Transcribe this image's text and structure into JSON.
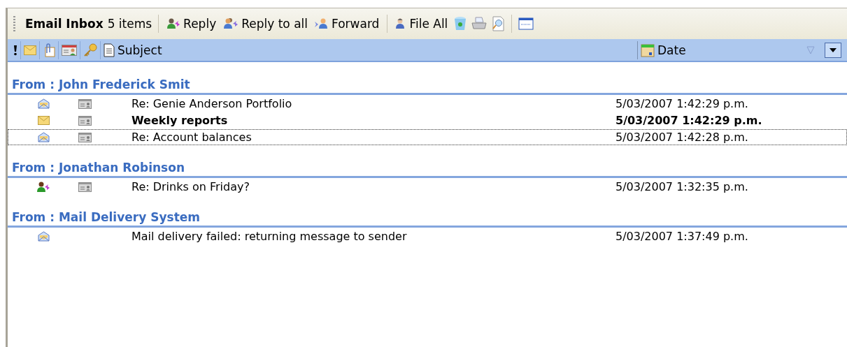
{
  "toolbar": {
    "title": "Email Inbox",
    "count": "5 items",
    "buttons": [
      {
        "kind": "reply",
        "label": "Reply"
      },
      {
        "kind": "reply_all",
        "label": "Reply to all"
      },
      {
        "kind": "forward",
        "label": "Forward"
      },
      {
        "kind": "file",
        "label": "File All"
      },
      {
        "kind": "recycle"
      },
      {
        "kind": "print"
      },
      {
        "kind": "preview"
      },
      {
        "kind": "window"
      }
    ]
  },
  "columns": [
    {
      "kind": "importance"
    },
    {
      "kind": "status"
    },
    {
      "kind": "attachment"
    },
    {
      "kind": "card"
    },
    {
      "kind": "key"
    },
    {
      "kind": "subject",
      "label": "Subject"
    },
    {
      "kind": "date",
      "label": "Date"
    }
  ],
  "groups": [
    {
      "title": "From : John Frederick Smit",
      "rows": [
        {
          "kind": "read",
          "has_card": true,
          "subject": "Re: Genie Anderson Portfolio",
          "date": "5/03/2007 1:42:29 p.m.",
          "unread": false,
          "focused": false
        },
        {
          "kind": "unread",
          "has_card": true,
          "subject": "Weekly reports",
          "date": "5/03/2007 1:42:29 p.m.",
          "unread": true,
          "focused": false
        },
        {
          "kind": "read",
          "has_card": true,
          "subject": "Re: Account balances",
          "date": "5/03/2007 1:42:28 p.m.",
          "unread": false,
          "focused": true
        }
      ]
    },
    {
      "title": "From : Jonathan Robinson",
      "rows": [
        {
          "kind": "replied",
          "has_card": true,
          "subject": "Re: Drinks on Friday?",
          "date": "5/03/2007 1:32:35 p.m.",
          "unread": false,
          "focused": false
        }
      ]
    },
    {
      "title": "From : Mail Delivery System",
      "rows": [
        {
          "kind": "read",
          "has_card": false,
          "subject": "Mail delivery failed: returning message to sender",
          "date": "5/03/2007 1:37:49 p.m.",
          "unread": false,
          "focused": false
        }
      ]
    }
  ]
}
